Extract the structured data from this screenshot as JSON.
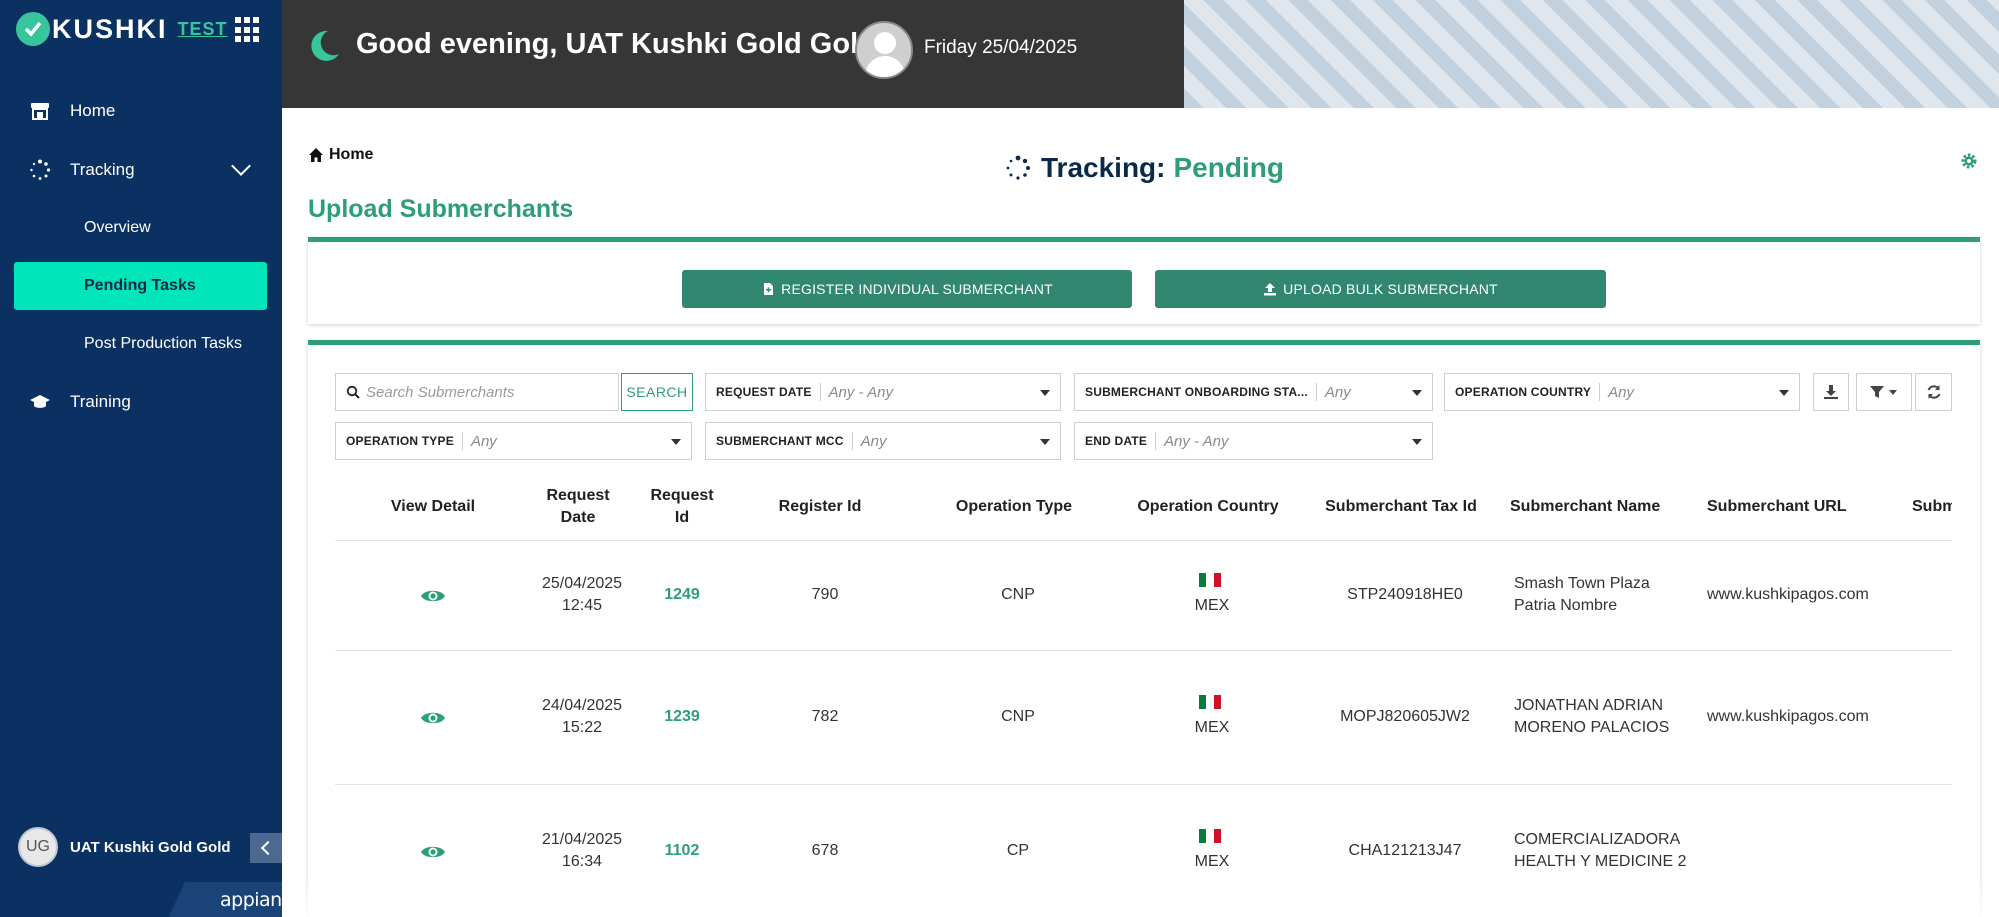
{
  "brand": {
    "name": "KUSHKI",
    "env": "TEST"
  },
  "sidebar": {
    "items": [
      {
        "label": "Home",
        "icon": "store-icon"
      },
      {
        "label": "Tracking",
        "icon": "spinner-icon"
      },
      {
        "label": "Overview"
      },
      {
        "label": "Pending Tasks",
        "active": true
      },
      {
        "label": "Post Production Tasks"
      },
      {
        "label": "Training",
        "icon": "graduation-cap-icon"
      }
    ],
    "user_initials": "UG",
    "user_name": "UAT Kushki Gold Gold",
    "footer_brand": "appian"
  },
  "header": {
    "greeting": "Good evening, UAT Kushki Gold Gold",
    "date": "Friday 25/04/2025"
  },
  "breadcrumb": {
    "label": "Home"
  },
  "title": {
    "prefix": "Tracking:",
    "status": "Pending"
  },
  "section": {
    "title": "Upload Submerchants"
  },
  "actions": {
    "register_label": "REGISTER INDIVIDUAL SUBMERCHANT",
    "upload_label": "UPLOAD BULK SUBMERCHANT"
  },
  "filters": {
    "search_placeholder": "Search Submerchants",
    "search_button": "SEARCH",
    "request_date": {
      "label": "REQUEST DATE",
      "value": "Any - Any"
    },
    "onboarding_status": {
      "label": "SUBMERCHANT ONBOARDING STA...",
      "value": "Any"
    },
    "operation_country": {
      "label": "OPERATION COUNTRY",
      "value": "Any"
    },
    "operation_type": {
      "label": "OPERATION TYPE",
      "value": "Any"
    },
    "submerchant_mcc": {
      "label": "SUBMERCHANT MCC",
      "value": "Any"
    },
    "end_date": {
      "label": "END DATE",
      "value": "Any - Any"
    }
  },
  "table": {
    "headers": {
      "view_detail": "View Detail",
      "request_date_1": "Request",
      "request_date_2": "Date",
      "request_id_1": "Request",
      "request_id_2": "Id",
      "register_id": "Register Id",
      "operation_type": "Operation Type",
      "operation_country": "Operation Country",
      "tax_id": "Submerchant Tax Id",
      "name": "Submerchant Name",
      "url": "Submerchant URL",
      "next": "Subm"
    },
    "rows": [
      {
        "date": "25/04/2025",
        "time": "12:45",
        "request_id": "1249",
        "register_id": "790",
        "op_type": "CNP",
        "country": "MEX",
        "tax_id": "STP240918HE0",
        "name_1": "Smash Town Plaza",
        "name_2": "Patria Nombre",
        "url": "www.kushkipagos.com"
      },
      {
        "date": "24/04/2025",
        "time": "15:22",
        "request_id": "1239",
        "register_id": "782",
        "op_type": "CNP",
        "country": "MEX",
        "tax_id": "MOPJ820605JW2",
        "name_1": "JONATHAN ADRIAN",
        "name_2": "MORENO PALACIOS",
        "url": "www.kushkipagos.com"
      },
      {
        "date": "21/04/2025",
        "time": "16:34",
        "request_id": "1102",
        "register_id": "678",
        "op_type": "CP",
        "country": "MEX",
        "tax_id": "CHA121213J47",
        "name_1": "COMERCIALIZADORA",
        "name_2": "HEALTH Y MEDICINE 2",
        "url": ""
      }
    ]
  },
  "colors": {
    "sidebar_bg": "#0a3161",
    "accent_green": "#2e9d7a",
    "active_nav": "#00e6b8",
    "button_green": "#31876f",
    "header_bg": "#363636"
  }
}
